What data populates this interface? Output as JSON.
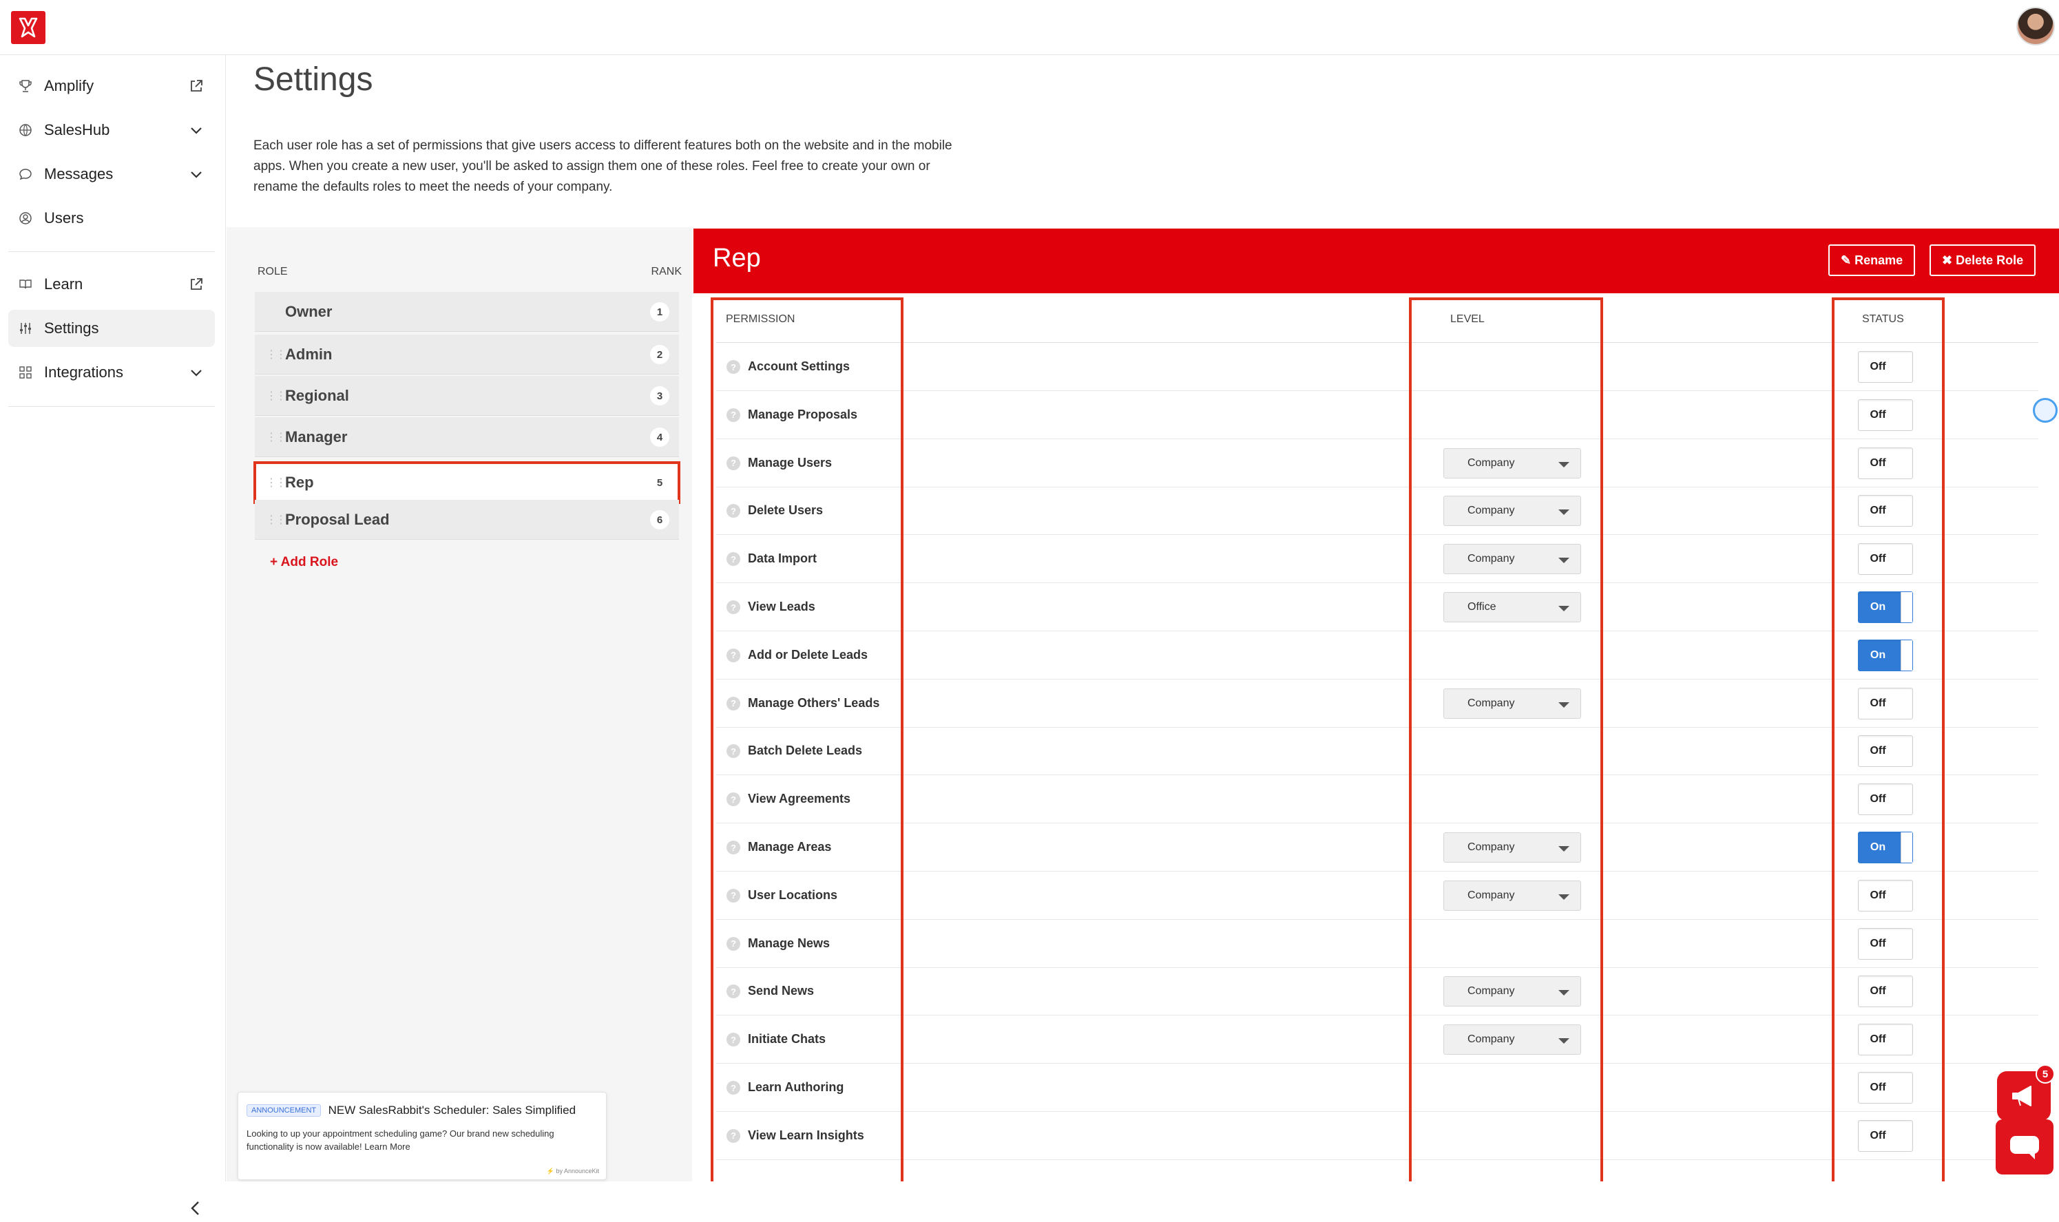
{
  "sidebar": {
    "items": [
      {
        "label": "Amplify",
        "icon": "trophy-icon",
        "trail": "external-link-icon"
      },
      {
        "label": "SalesHub",
        "icon": "globe-icon",
        "trail": "chevron-down-icon"
      },
      {
        "label": "Messages",
        "icon": "chat-bubble-icon",
        "trail": "chevron-down-icon"
      },
      {
        "label": "Users",
        "icon": "user-circle-icon",
        "trail": ""
      },
      {
        "label": "Learn",
        "icon": "book-icon",
        "trail": "external-link-icon"
      },
      {
        "label": "Settings",
        "icon": "sliders-icon",
        "trail": ""
      },
      {
        "label": "Integrations",
        "icon": "grid-icon",
        "trail": "chevron-down-icon"
      }
    ]
  },
  "page": {
    "title": "Settings",
    "intro": "Each user role has a set of permissions that give users access to different features both on the website and in the mobile apps. When you create a new user, you'll be asked to assign them one of these roles. Feel free to create your own or rename the defaults roles to meet the needs of your company."
  },
  "roles": {
    "header_role": "ROLE",
    "header_rank": "RANK",
    "items": [
      {
        "name": "Owner",
        "rank": "1"
      },
      {
        "name": "Admin",
        "rank": "2"
      },
      {
        "name": "Regional",
        "rank": "3"
      },
      {
        "name": "Manager",
        "rank": "4"
      },
      {
        "name": "Rep",
        "rank": "5"
      },
      {
        "name": "Proposal Lead",
        "rank": "6"
      }
    ],
    "selected": "Rep",
    "add_label": "+ Add Role"
  },
  "detail": {
    "title": "Rep",
    "rename_label": "✎ Rename",
    "delete_label": "✖ Delete Role",
    "col_permission": "PERMISSION",
    "col_level": "LEVEL",
    "col_status": "STATUS",
    "permissions": [
      {
        "name": "Account Settings",
        "level": "",
        "status": "Off"
      },
      {
        "name": "Manage Proposals",
        "level": "",
        "status": "Off"
      },
      {
        "name": "Manage Users",
        "level": "Company",
        "status": "Off"
      },
      {
        "name": "Delete Users",
        "level": "Company",
        "status": "Off"
      },
      {
        "name": "Data Import",
        "level": "Company",
        "status": "Off"
      },
      {
        "name": "View Leads",
        "level": "Office",
        "status": "On"
      },
      {
        "name": "Add or Delete Leads",
        "level": "",
        "status": "On"
      },
      {
        "name": "Manage Others' Leads",
        "level": "Company",
        "status": "Off"
      },
      {
        "name": "Batch Delete Leads",
        "level": "",
        "status": "Off"
      },
      {
        "name": "View Agreements",
        "level": "",
        "status": "Off"
      },
      {
        "name": "Manage Areas",
        "level": "Company",
        "status": "On"
      },
      {
        "name": "User Locations",
        "level": "Company",
        "status": "Off"
      },
      {
        "name": "Manage News",
        "level": "",
        "status": "Off"
      },
      {
        "name": "Send News",
        "level": "Company",
        "status": "Off"
      },
      {
        "name": "Initiate Chats",
        "level": "Company",
        "status": "Off"
      },
      {
        "name": "Learn Authoring",
        "level": "",
        "status": "Off"
      },
      {
        "name": "View Learn Insights",
        "level": "",
        "status": "Off"
      }
    ]
  },
  "announcement": {
    "badge": "ANNOUNCEMENT",
    "title": "NEW SalesRabbit's Scheduler: Sales Simplified",
    "body": "Looking to up your appointment scheduling game? Our brand new scheduling functionality is now available! Learn More",
    "footer": "⚡ by AnnounceKit"
  },
  "widgets": {
    "notification_count": "5"
  },
  "colors": {
    "brand_red": "#e0000b",
    "toggle_on": "#2f7bd6",
    "highlight_box": "#e0341c"
  }
}
